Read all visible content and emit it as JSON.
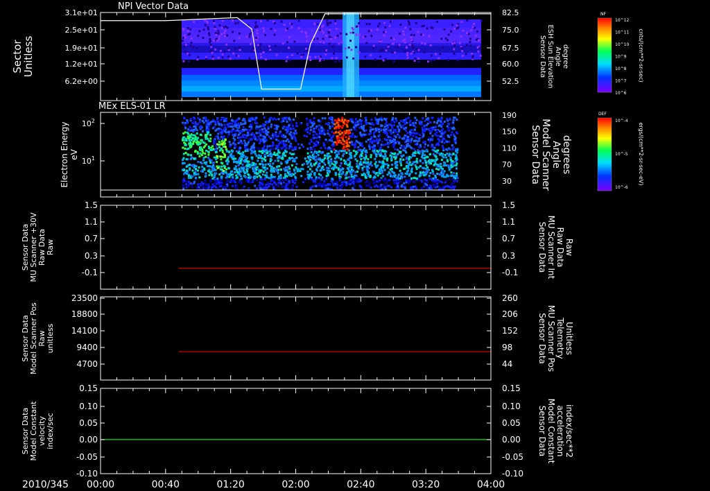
{
  "date_label": "2010/345",
  "time_ticks": [
    "00:00",
    "00:40",
    "01:20",
    "02:00",
    "02:40",
    "03:20",
    "04:00"
  ],
  "chart_data": [
    {
      "type": "heatmap",
      "title": "NPI Vector Data",
      "ylabel": [
        "Sector",
        "Unitless"
      ],
      "yticks": [
        "3.1e+01",
        "2.5e+01",
        "1.9e+01",
        "1.2e+01",
        "6.2e+00"
      ],
      "y2label": [
        "Sensor Data",
        "ESH Sun Elevation",
        "Angle",
        "degree"
      ],
      "y2ticks": [
        "82.5",
        "75.0",
        "67.5",
        "60.0",
        "52.5"
      ],
      "colorbar": {
        "label": "NF",
        "units": "cnts/(cm**2-sr-sec)",
        "ticks": [
          "10^12",
          "10^11",
          "10^10",
          "10^9",
          "10^8",
          "10^7",
          "10^6"
        ]
      },
      "line": {
        "color": "#ffffff",
        "x_hours": [
          0.0,
          0.67,
          1.4,
          1.55,
          1.65,
          2.05,
          2.15,
          2.3,
          4.0
        ],
        "y_deg": [
          79.3,
          79.3,
          80.5,
          76.0,
          52.5,
          52.5,
          70.0,
          82.0,
          82.0
        ]
      }
    },
    {
      "type": "heatmap",
      "title": "MEx ELS-01 LR",
      "ylabel": [
        "Electron Energy",
        "eV"
      ],
      "yticks": [
        "10^2",
        "10^1"
      ],
      "y2label": [
        "Sensor Data",
        "Model Scanner",
        "Angle",
        "degrees"
      ],
      "y2ticks": [
        "190",
        "150",
        "110",
        "70",
        "30"
      ],
      "colorbar": {
        "label": "DEF",
        "units": "ergs/(cm**2-sr-sec-eV)",
        "ticks": [
          "10^-4",
          "10^-5",
          "10^-6"
        ]
      }
    },
    {
      "type": "line",
      "ylabel": [
        "Sensor Data",
        "MU Scanner +30V",
        "Raw Data",
        "Raw"
      ],
      "yticks": [
        "1.5",
        "1.1",
        "0.7",
        "0.3",
        "-0.1"
      ],
      "ylim": [
        -0.5,
        1.5
      ],
      "y2label": [
        "Sensor Data",
        "MU Scanner Int",
        "Raw Data",
        "Raw"
      ],
      "y2ticks": [
        "1.5",
        "1.1",
        "0.7",
        "0.3",
        "-0.1"
      ],
      "y2color": "#ff0000",
      "series": [
        {
          "color": "#cc0000",
          "x_hours": [
            0.8,
            4.0
          ],
          "y": [
            0.0,
            0.0
          ]
        }
      ]
    },
    {
      "type": "line",
      "ylabel": [
        "Sensor Data",
        "Model Scanner Pos",
        "Raw",
        "unitless"
      ],
      "yticks": [
        "23500",
        "18800",
        "14100",
        "9400",
        "4700"
      ],
      "ylim": [
        0,
        23500
      ],
      "y2label": [
        "Sensor Data",
        "MU Scanner Pos",
        "Telemetry",
        "Unitless"
      ],
      "y2ticks": [
        "260",
        "206",
        "152",
        "98",
        "44"
      ],
      "y2color": "#ff0000",
      "series": [
        {
          "color": "#cc0000",
          "x_hours": [
            0.8,
            4.0
          ],
          "y": [
            8000,
            8000
          ]
        }
      ]
    },
    {
      "type": "line",
      "ylabel": [
        "Sensor Data",
        "Model Constant",
        "velocity",
        "index/sec"
      ],
      "yticks": [
        "0.15",
        "0.10",
        "0.05",
        "0.00",
        "-0.05",
        "-0.10"
      ],
      "ylim": [
        -0.1,
        0.15
      ],
      "y2label": [
        "Sensor Data",
        "Model Constant",
        "acceleration",
        "index/sec**2"
      ],
      "y2ticks": [
        "0.15",
        "0.10",
        "0.05",
        "0.00",
        "-0.05",
        "-0.10"
      ],
      "y2color": "#00ff00",
      "series": [
        {
          "color": "#00ff00",
          "x_hours": [
            0.0,
            4.0
          ],
          "y": [
            0.0,
            0.0
          ]
        }
      ]
    }
  ]
}
